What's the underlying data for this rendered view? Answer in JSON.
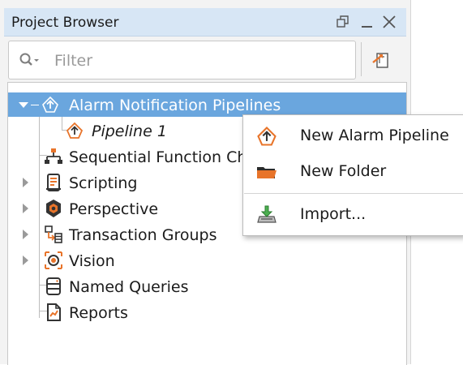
{
  "panel": {
    "title": "Project Browser",
    "controls": [
      "restore-icon",
      "minimize-icon",
      "close-icon"
    ]
  },
  "filter": {
    "placeholder": "Filter",
    "value": ""
  },
  "tree": {
    "items": [
      {
        "label": "Alarm Notification Pipelines",
        "icon": "alarm-pipeline-icon",
        "expanded": true,
        "selected": true
      },
      {
        "label": "Pipeline 1",
        "icon": "alarm-pipeline-icon",
        "italic": true
      },
      {
        "label": "Sequential Function Charts",
        "icon": "sfc-icon"
      },
      {
        "label": "Scripting",
        "icon": "scripting-icon",
        "expandable": true
      },
      {
        "label": "Perspective",
        "icon": "perspective-icon",
        "expandable": true
      },
      {
        "label": "Transaction Groups",
        "icon": "transaction-groups-icon",
        "expandable": true
      },
      {
        "label": "Vision",
        "icon": "vision-icon",
        "expandable": true
      },
      {
        "label": "Named Queries",
        "icon": "named-queries-icon"
      },
      {
        "label": "Reports",
        "icon": "reports-icon"
      }
    ]
  },
  "context_menu": {
    "items": [
      {
        "label": "New Alarm Pipeline",
        "icon": "alarm-pipeline-icon"
      },
      {
        "label": "New Folder",
        "icon": "folder-icon"
      },
      {
        "label": "Import...",
        "icon": "import-icon"
      }
    ]
  },
  "colors": {
    "titlebar": "#d7e6f5",
    "selection": "#6aa6de",
    "accent_orange": "#e8742a"
  }
}
